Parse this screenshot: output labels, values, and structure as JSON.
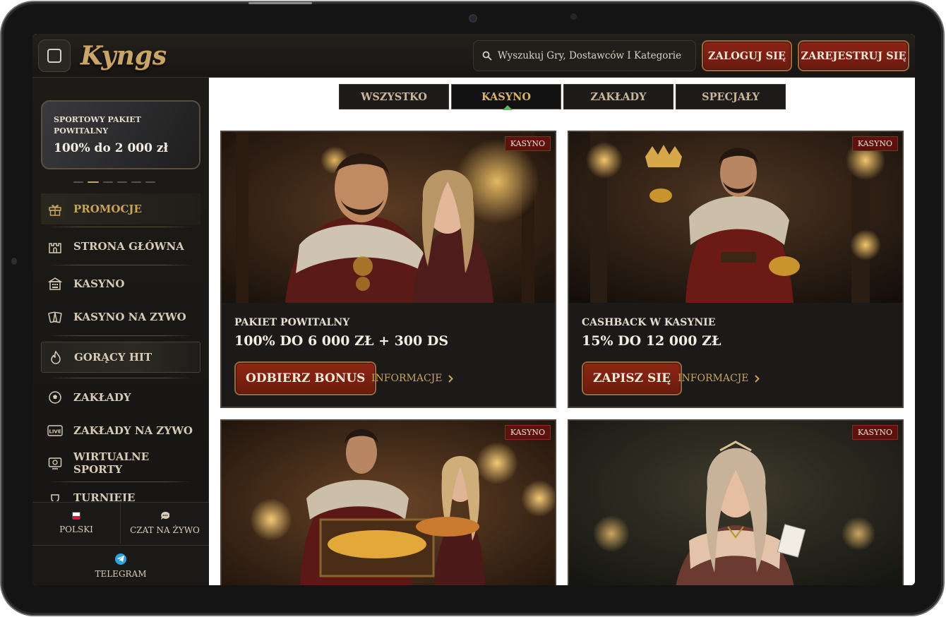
{
  "header": {
    "logo_text": "Kyngs",
    "search_placeholder": "Wyszukuj Gry, Dostawców I Kategorie",
    "login_label": "ZALOGUJ SIĘ",
    "register_label": "ZAREJESTRUJ SIĘ"
  },
  "sidebar": {
    "promo": {
      "title": "SPORTOWY PAKIET POWITALNY",
      "subtitle": "100% do 2 000 zł"
    },
    "items": [
      {
        "label": "PROMOCJE",
        "icon": "gift-icon"
      },
      {
        "label": "STRONA GŁÓWNA",
        "icon": "castle-icon"
      },
      {
        "label": "KASYNO",
        "icon": "casino-building-icon"
      },
      {
        "label": "KASYNO NA ZYWO",
        "icon": "cards-icon"
      },
      {
        "label": "GORĄCY HIT",
        "icon": "flame-icon"
      },
      {
        "label": "ZAKŁADY",
        "icon": "soccer-ball-icon"
      },
      {
        "label": "ZAKŁADY NA ZYWO",
        "icon": "live-icon"
      },
      {
        "label": "WIRTUALNE SPORTY",
        "icon": "screen-ball-icon"
      },
      {
        "label": "TURNIEJE",
        "icon": "trophy-icon"
      }
    ],
    "language_label": "POLSKI",
    "chat_label": "CZAT NA ŻYWO",
    "telegram_label": "TELEGRAM"
  },
  "tabs": [
    {
      "label": "WSZYSTKO",
      "active": false
    },
    {
      "label": "KASYNO",
      "active": true
    },
    {
      "label": "ZAKŁADY",
      "active": false
    },
    {
      "label": "SPECJAŁY",
      "active": false
    }
  ],
  "cards": [
    {
      "badge": "KASYNO",
      "title": "PAKIET POWITALNY",
      "subtitle": "100% DO 6 000 ZŁ + 300 DS",
      "cta": "ODBIERZ BONUS",
      "info": "INFORMACJE"
    },
    {
      "badge": "KASYNO",
      "title": "CASHBACK W KASYNIE",
      "subtitle": "15% DO 12 000 ZŁ",
      "cta": "ZAPISZ SIĘ",
      "info": "INFORMACJE"
    },
    {
      "badge": "KASYNO"
    },
    {
      "badge": "KASYNO"
    }
  ],
  "colors": {
    "accent_gold": "#c9a25c",
    "button_red": "#8c2414",
    "header_bg": "#1e1b18"
  }
}
